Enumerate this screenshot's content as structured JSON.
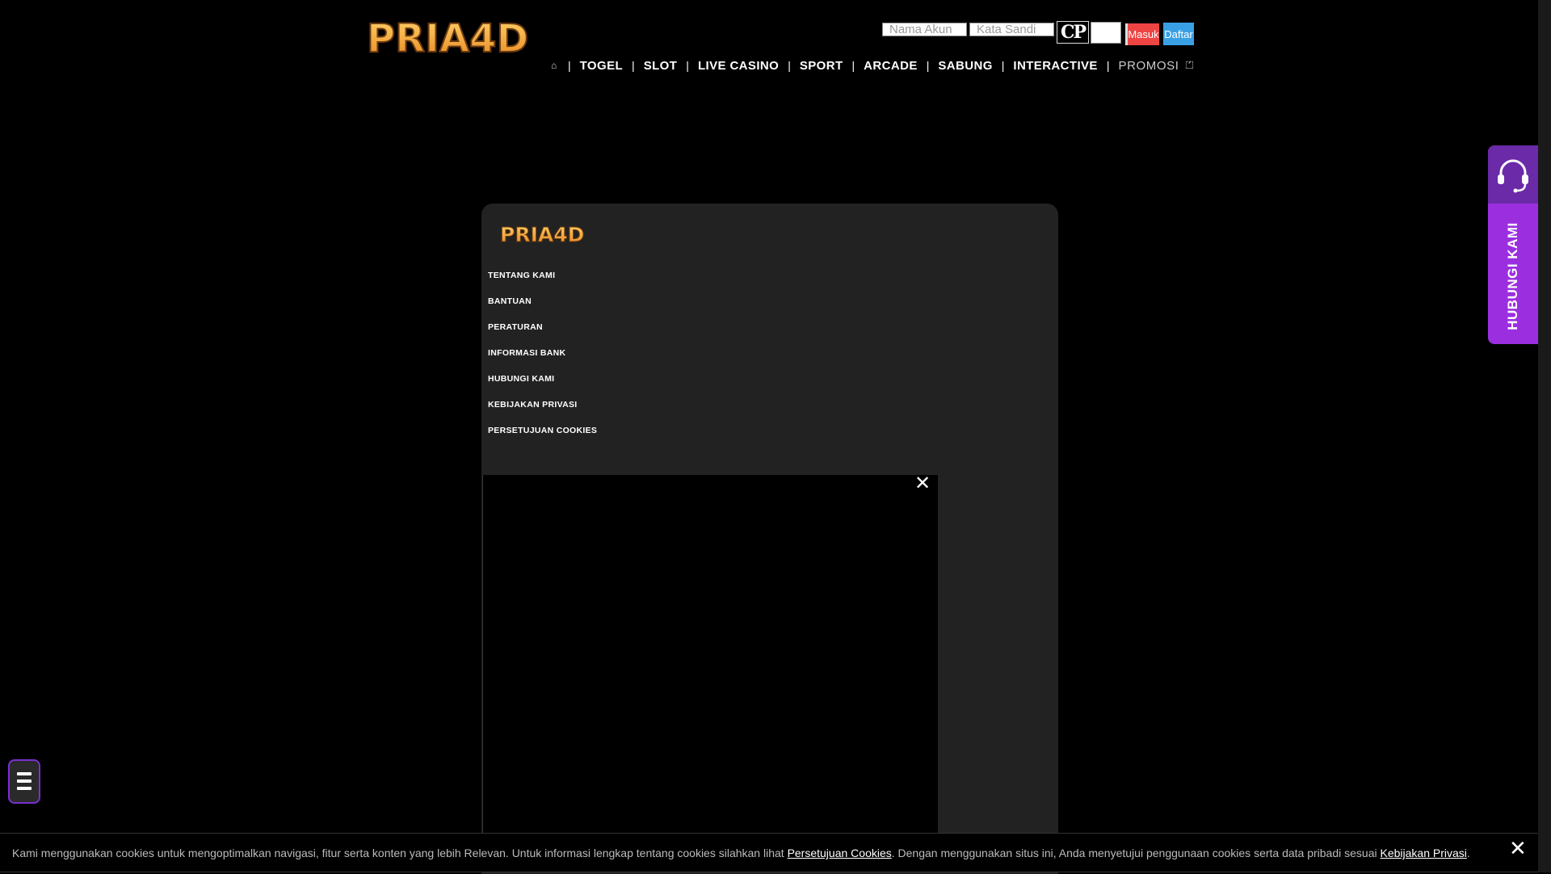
{
  "header": {
    "logo_text": "PRIA4D",
    "login": {
      "username_placeholder": "Nama Akun",
      "password_placeholder": "Kata Sandi",
      "captcha_text": "CP",
      "login_button": "Masuk",
      "register_button": "Daftar"
    },
    "nav": {
      "items": [
        "TOGEL",
        "SLOT",
        "LIVE CASINO",
        "SPORT",
        "ARCADE",
        "SABUNG",
        "INTERACTIVE",
        "PROMOSI"
      ],
      "home_icon": "home-icon",
      "promo_icon": "gift-icon"
    }
  },
  "footer": {
    "logo_text": "PRIA4D",
    "links": [
      "TENTANG KAMI",
      "BANTUAN",
      "PERATURAN",
      "INFORMASI BANK",
      "HUBUNGI KAMI",
      "KEBIJAKAN PRIVASI",
      "PERSETUJUAN COOKIES"
    ]
  },
  "contact_widget": {
    "label": "HUBUNGI KAMI",
    "icon": "headset-icon"
  },
  "cookie_bar": {
    "text_before": "Kami menggunakan cookies untuk mengoptimalkan navigasi, fitur serta konten yang lebih Relevan. Untuk informasi lengkap tentang cookies silahkan lihat ",
    "link1": "Persetujuan Cookies",
    "text_middle": ". Dengan menggunakan situs ini, Anda menyetujui penggunaan cookies serta data pribadi sesuai ",
    "link2": "Kebijakan Privasi",
    "text_after": "."
  },
  "colors": {
    "login_red": "#ee4444",
    "register_blue": "#3aa0e6",
    "contact_purple": "#9b2fe0",
    "logo_orange": "#f0a030"
  }
}
